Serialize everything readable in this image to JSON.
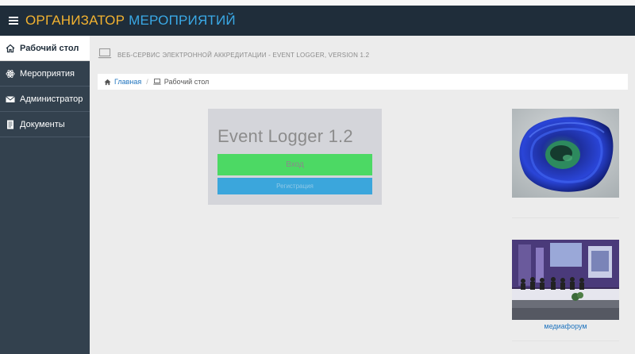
{
  "app": {
    "brand_part1": "ОРГАНИЗАТОР",
    "brand_part2": "МЕРОПРИЯТИЙ",
    "brand_color1": "#f2b230",
    "brand_color2": "#3aa9e6"
  },
  "sidebar": {
    "items": [
      {
        "label": "Рабочий стол",
        "icon": "home-icon",
        "active": true
      },
      {
        "label": "Мероприятия",
        "icon": "atom-icon",
        "active": false
      },
      {
        "label": "Администратор",
        "icon": "envelope-icon",
        "active": false
      },
      {
        "label": "Документы",
        "icon": "document-icon",
        "active": false
      }
    ]
  },
  "header": {
    "title": "ВЕБ-СЕРВИС ЭЛЕКТРОННОЙ АККРЕДИТАЦИИ - EVENT LOGGER, VERSION 1.2",
    "icon": "laptop-icon"
  },
  "breadcrumb": {
    "home": "Главная",
    "current": "Рабочий стол"
  },
  "login": {
    "title": "Event Logger 1.2",
    "login_label": "Вход",
    "register_label": "Регистрация"
  },
  "media": {
    "caption": "медиафорум"
  },
  "colors": {
    "topbar": "#1f2d3a",
    "sidebar": "#33414e",
    "login_button": "#4cd964",
    "register_button": "#3ba6dc",
    "link": "#1e73be"
  }
}
